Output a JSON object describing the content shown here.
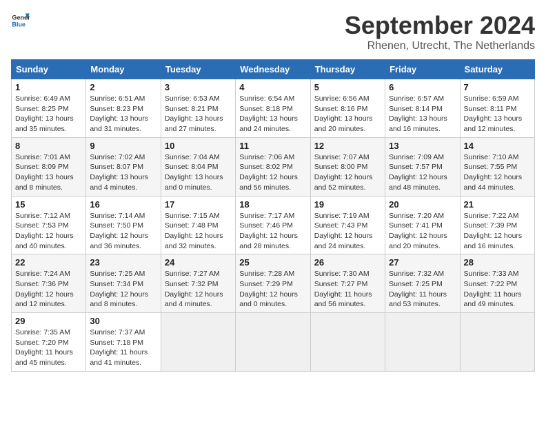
{
  "header": {
    "logo_line1": "General",
    "logo_line2": "Blue",
    "month": "September 2024",
    "location": "Rhenen, Utrecht, The Netherlands"
  },
  "columns": [
    "Sunday",
    "Monday",
    "Tuesday",
    "Wednesday",
    "Thursday",
    "Friday",
    "Saturday"
  ],
  "weeks": [
    [
      {
        "day": "1",
        "info": "Sunrise: 6:49 AM\nSunset: 8:25 PM\nDaylight: 13 hours\nand 35 minutes."
      },
      {
        "day": "2",
        "info": "Sunrise: 6:51 AM\nSunset: 8:23 PM\nDaylight: 13 hours\nand 31 minutes."
      },
      {
        "day": "3",
        "info": "Sunrise: 6:53 AM\nSunset: 8:21 PM\nDaylight: 13 hours\nand 27 minutes."
      },
      {
        "day": "4",
        "info": "Sunrise: 6:54 AM\nSunset: 8:18 PM\nDaylight: 13 hours\nand 24 minutes."
      },
      {
        "day": "5",
        "info": "Sunrise: 6:56 AM\nSunset: 8:16 PM\nDaylight: 13 hours\nand 20 minutes."
      },
      {
        "day": "6",
        "info": "Sunrise: 6:57 AM\nSunset: 8:14 PM\nDaylight: 13 hours\nand 16 minutes."
      },
      {
        "day": "7",
        "info": "Sunrise: 6:59 AM\nSunset: 8:11 PM\nDaylight: 13 hours\nand 12 minutes."
      }
    ],
    [
      {
        "day": "8",
        "info": "Sunrise: 7:01 AM\nSunset: 8:09 PM\nDaylight: 13 hours\nand 8 minutes."
      },
      {
        "day": "9",
        "info": "Sunrise: 7:02 AM\nSunset: 8:07 PM\nDaylight: 13 hours\nand 4 minutes."
      },
      {
        "day": "10",
        "info": "Sunrise: 7:04 AM\nSunset: 8:04 PM\nDaylight: 13 hours\nand 0 minutes."
      },
      {
        "day": "11",
        "info": "Sunrise: 7:06 AM\nSunset: 8:02 PM\nDaylight: 12 hours\nand 56 minutes."
      },
      {
        "day": "12",
        "info": "Sunrise: 7:07 AM\nSunset: 8:00 PM\nDaylight: 12 hours\nand 52 minutes."
      },
      {
        "day": "13",
        "info": "Sunrise: 7:09 AM\nSunset: 7:57 PM\nDaylight: 12 hours\nand 48 minutes."
      },
      {
        "day": "14",
        "info": "Sunrise: 7:10 AM\nSunset: 7:55 PM\nDaylight: 12 hours\nand 44 minutes."
      }
    ],
    [
      {
        "day": "15",
        "info": "Sunrise: 7:12 AM\nSunset: 7:53 PM\nDaylight: 12 hours\nand 40 minutes."
      },
      {
        "day": "16",
        "info": "Sunrise: 7:14 AM\nSunset: 7:50 PM\nDaylight: 12 hours\nand 36 minutes."
      },
      {
        "day": "17",
        "info": "Sunrise: 7:15 AM\nSunset: 7:48 PM\nDaylight: 12 hours\nand 32 minutes."
      },
      {
        "day": "18",
        "info": "Sunrise: 7:17 AM\nSunset: 7:46 PM\nDaylight: 12 hours\nand 28 minutes."
      },
      {
        "day": "19",
        "info": "Sunrise: 7:19 AM\nSunset: 7:43 PM\nDaylight: 12 hours\nand 24 minutes."
      },
      {
        "day": "20",
        "info": "Sunrise: 7:20 AM\nSunset: 7:41 PM\nDaylight: 12 hours\nand 20 minutes."
      },
      {
        "day": "21",
        "info": "Sunrise: 7:22 AM\nSunset: 7:39 PM\nDaylight: 12 hours\nand 16 minutes."
      }
    ],
    [
      {
        "day": "22",
        "info": "Sunrise: 7:24 AM\nSunset: 7:36 PM\nDaylight: 12 hours\nand 12 minutes."
      },
      {
        "day": "23",
        "info": "Sunrise: 7:25 AM\nSunset: 7:34 PM\nDaylight: 12 hours\nand 8 minutes."
      },
      {
        "day": "24",
        "info": "Sunrise: 7:27 AM\nSunset: 7:32 PM\nDaylight: 12 hours\nand 4 minutes."
      },
      {
        "day": "25",
        "info": "Sunrise: 7:28 AM\nSunset: 7:29 PM\nDaylight: 12 hours\nand 0 minutes."
      },
      {
        "day": "26",
        "info": "Sunrise: 7:30 AM\nSunset: 7:27 PM\nDaylight: 11 hours\nand 56 minutes."
      },
      {
        "day": "27",
        "info": "Sunrise: 7:32 AM\nSunset: 7:25 PM\nDaylight: 11 hours\nand 53 minutes."
      },
      {
        "day": "28",
        "info": "Sunrise: 7:33 AM\nSunset: 7:22 PM\nDaylight: 11 hours\nand 49 minutes."
      }
    ],
    [
      {
        "day": "29",
        "info": "Sunrise: 7:35 AM\nSunset: 7:20 PM\nDaylight: 11 hours\nand 45 minutes."
      },
      {
        "day": "30",
        "info": "Sunrise: 7:37 AM\nSunset: 7:18 PM\nDaylight: 11 hours\nand 41 minutes."
      },
      null,
      null,
      null,
      null,
      null
    ]
  ]
}
